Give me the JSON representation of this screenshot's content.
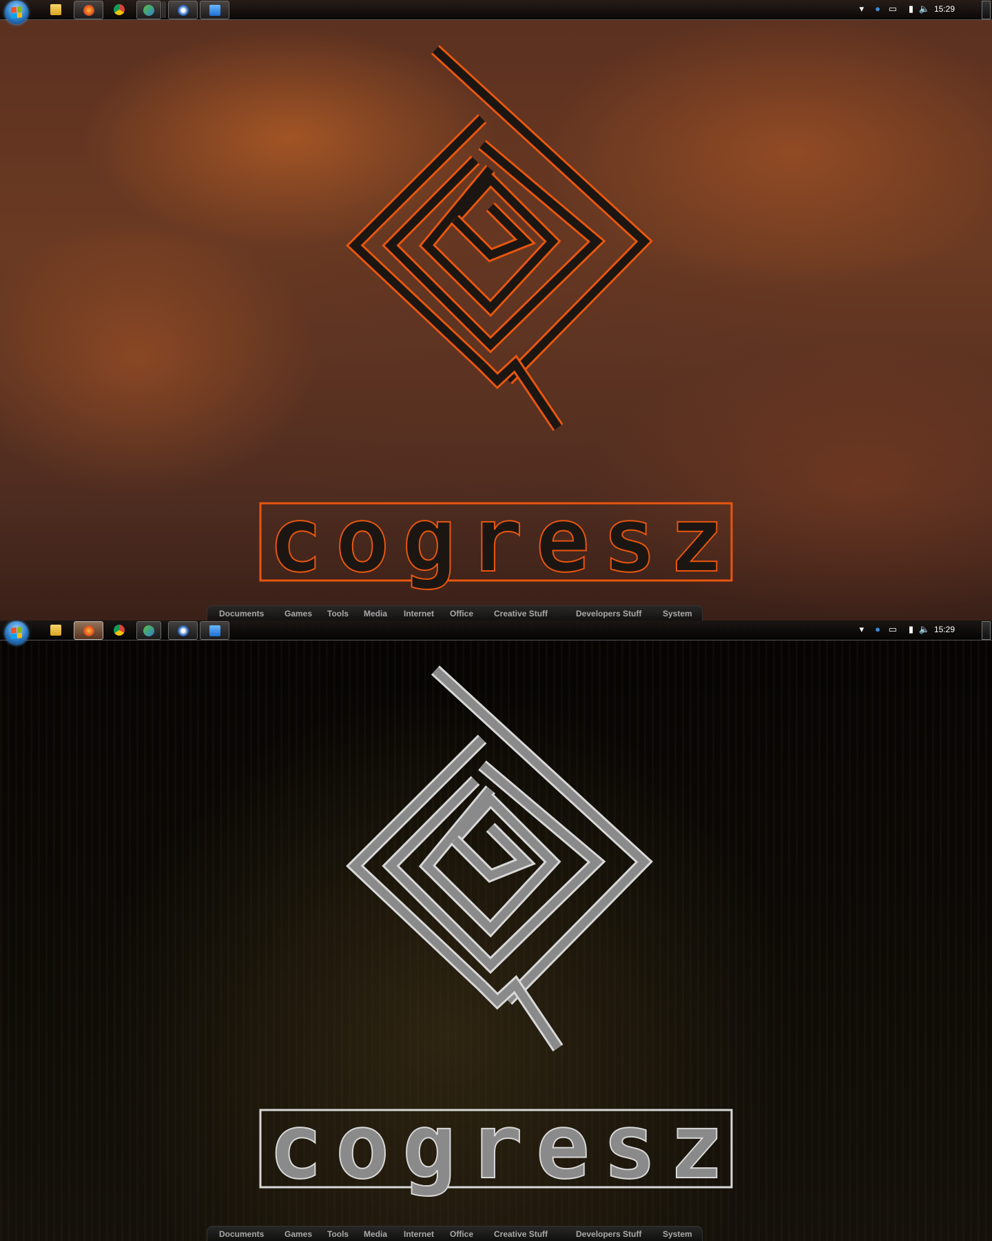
{
  "screens": [
    {
      "wallpaper": "rust",
      "logo_text": "cogresz",
      "active_taskbar_item": null
    },
    {
      "wallpaper": "dark-wood-metal",
      "logo_text": "cogresz",
      "active_taskbar_item": "firefox"
    }
  ],
  "taskbar": {
    "items": [
      {
        "name": "windows-explorer",
        "icon": "folder-icon"
      },
      {
        "name": "firefox",
        "icon": "firefox-icon"
      },
      {
        "name": "chrome",
        "icon": "chrome-icon"
      },
      {
        "name": "windows-live-messenger",
        "icon": "messenger-icon"
      },
      {
        "name": "thunderbird",
        "icon": "thunderbird-icon"
      },
      {
        "name": "remote-desktop",
        "icon": "monitor-icon"
      }
    ],
    "tray_icons": [
      "chevron-up-icon",
      "itunes-icon",
      "network-icon",
      "power-icon",
      "volume-icon"
    ],
    "clock": "15:29"
  },
  "menu": {
    "items": [
      "Documents",
      "Games",
      "Tools",
      "Media",
      "Internet",
      "Office",
      "Creative Stuff",
      "Developers Stuff",
      "System"
    ]
  },
  "colors": {
    "menu_text": "#a9a9a9",
    "rust_glow": "#e25a12",
    "metal": "#b8b8b8"
  }
}
